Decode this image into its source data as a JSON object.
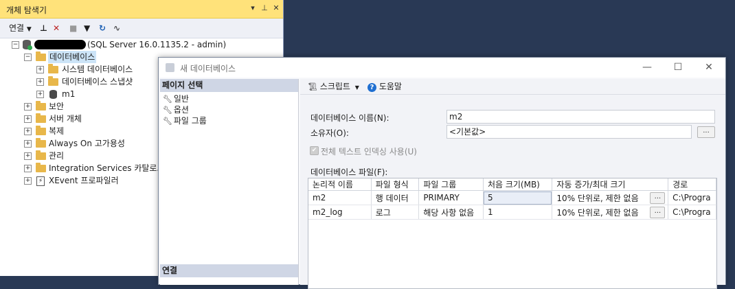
{
  "object_explorer": {
    "title": "개체 탐색기",
    "toolbar": {
      "connect_label": "연결"
    },
    "server_label": "(SQL Server 16.0.1135.2 - admin)",
    "nodes": {
      "databases": "데이터베이스",
      "system_db": "시스템 데이터베이스",
      "snapshots": "데이터베이스 스냅샷",
      "m1": "m1",
      "security": "보안",
      "server_objects": "서버 개체",
      "replication": "복제",
      "always_on": "Always On 고가용성",
      "management": "관리",
      "integration": "Integration Services 카탈로그",
      "xevent": "XEvent 프로파일러"
    }
  },
  "dialog": {
    "title": "새 데이터베이스",
    "pages_header": "페이지 선택",
    "pages": [
      "일반",
      "옵션",
      "파일 그룹"
    ],
    "connection_header": "연결",
    "toolbar": {
      "script": "스크립트",
      "help": "도움말"
    },
    "form": {
      "db_name_label": "데이터베이스 이름(N):",
      "db_name_value": "m2",
      "owner_label": "소유자(O):",
      "owner_value": "<기본값>",
      "owner_button": "...",
      "fulltext_label": "전체 텍스트 인덱싱 사용(U)",
      "fulltext_checked": true,
      "files_label": "데이터베이스 파일(F):"
    },
    "grid": {
      "columns": [
        "논리적 이름",
        "파일 형식",
        "파일 그룹",
        "처음 크기(MB)",
        "자동 증가/최대 크기",
        "경로"
      ],
      "rows": [
        {
          "name": "m2",
          "type": "행 데이터",
          "filegroup": "PRIMARY",
          "size": "5",
          "autogrow": "10% 단위로, 제한 없음",
          "btn": "...",
          "path": "C:\\Progra"
        },
        {
          "name": "m2_log",
          "type": "로그",
          "filegroup": "해당 사항 없음",
          "size": "1",
          "autogrow": "10% 단위로, 제한 없음",
          "btn": "...",
          "path": "C:\\Progra"
        }
      ]
    }
  },
  "colors": {
    "background": "#293955",
    "oe_title_bar": "#ffe27a",
    "folder": "#e8b74a",
    "pane_header": "#cfd6e5",
    "help_icon": "#1f6fd1"
  }
}
